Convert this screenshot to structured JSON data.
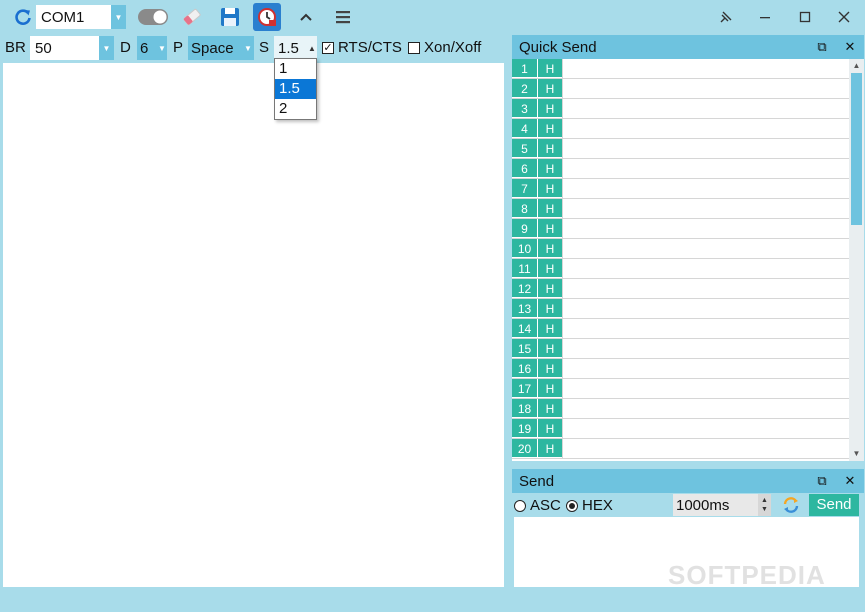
{
  "toolbar": {
    "port": "COM1",
    "icons": [
      "refresh-icon",
      "toggle-icon",
      "eraser-icon",
      "save-icon",
      "timer-icon",
      "chevron-up-icon",
      "menu-icon",
      "pin-icon",
      "minimize-icon",
      "maximize-icon",
      "close-icon"
    ]
  },
  "settings": {
    "br_label": "BR",
    "br_value": "50",
    "d_label": "D",
    "d_value": "6",
    "p_label": "P",
    "p_value": "Space",
    "s_label": "S",
    "s_value": "1.5",
    "rts_label": "RTS/CTS",
    "rts_checked": true,
    "xon_label": "Xon/Xoff",
    "xon_checked": false,
    "stop_options": [
      "1",
      "1.5",
      "2"
    ],
    "stop_selected": "1.5"
  },
  "quick_send": {
    "title": "Quick Send",
    "hex_label": "H",
    "rows": [
      "1",
      "2",
      "3",
      "4",
      "5",
      "6",
      "7",
      "8",
      "9",
      "10",
      "11",
      "12",
      "13",
      "14",
      "15",
      "16",
      "17",
      "18",
      "19",
      "20"
    ]
  },
  "send": {
    "title": "Send",
    "asc_label": "ASC",
    "hex_label": "HEX",
    "mode": "HEX",
    "interval": "1000ms",
    "send_label": "Send"
  },
  "watermark": "SOFTPEDIA",
  "colors": {
    "background": "#a8dcea",
    "accent": "#6ec3df",
    "green": "#2db7a0",
    "selection": "#0b77d6"
  }
}
